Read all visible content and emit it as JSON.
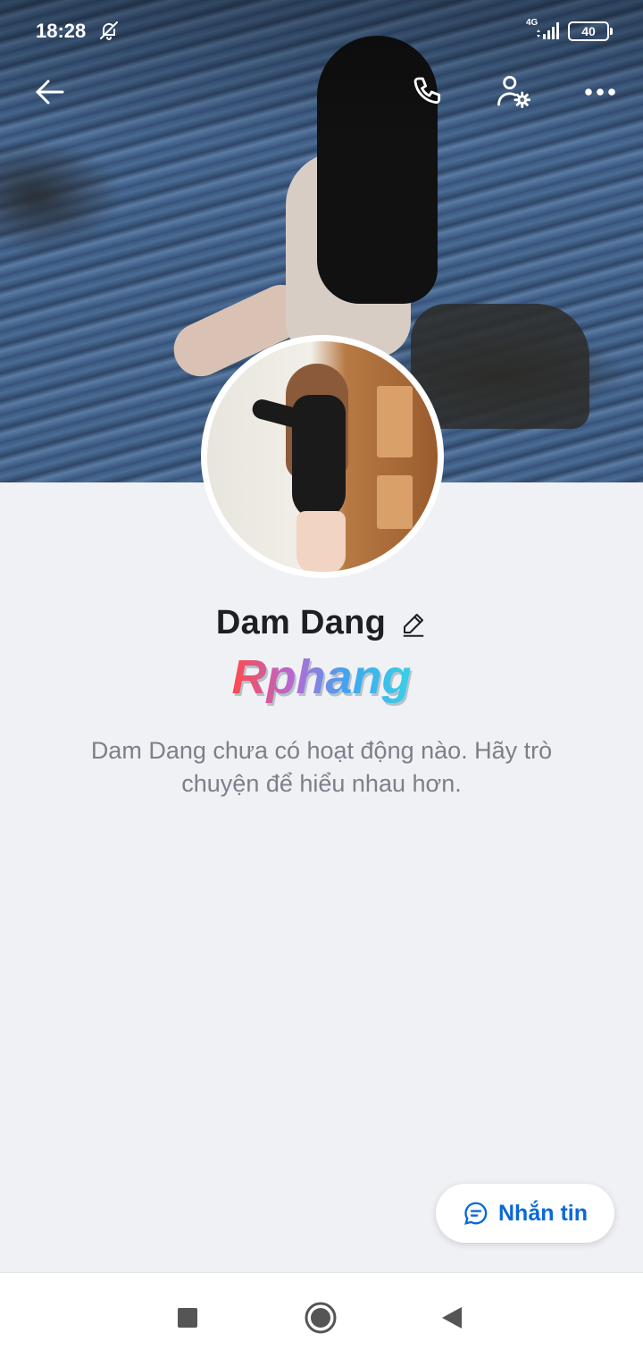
{
  "status_bar": {
    "time": "18:28",
    "network": "4G",
    "battery": "40"
  },
  "icons": {
    "back": "arrow-left-icon",
    "call": "phone-icon",
    "user_settings": "user-settings-icon",
    "more": "more-icon",
    "edit": "pencil-icon",
    "chat": "chat-icon"
  },
  "profile": {
    "name": "Dam Dang",
    "badge_text": "Rphang",
    "empty_message": "Dam Dang chưa có hoạt động nào. Hãy trò chuyện để hiểu nhau hơn."
  },
  "actions": {
    "message_button": "Nhắn tin"
  },
  "colors": {
    "accent": "#0a68d8",
    "background": "#f0f1f5",
    "muted_text": "#7b8089"
  }
}
